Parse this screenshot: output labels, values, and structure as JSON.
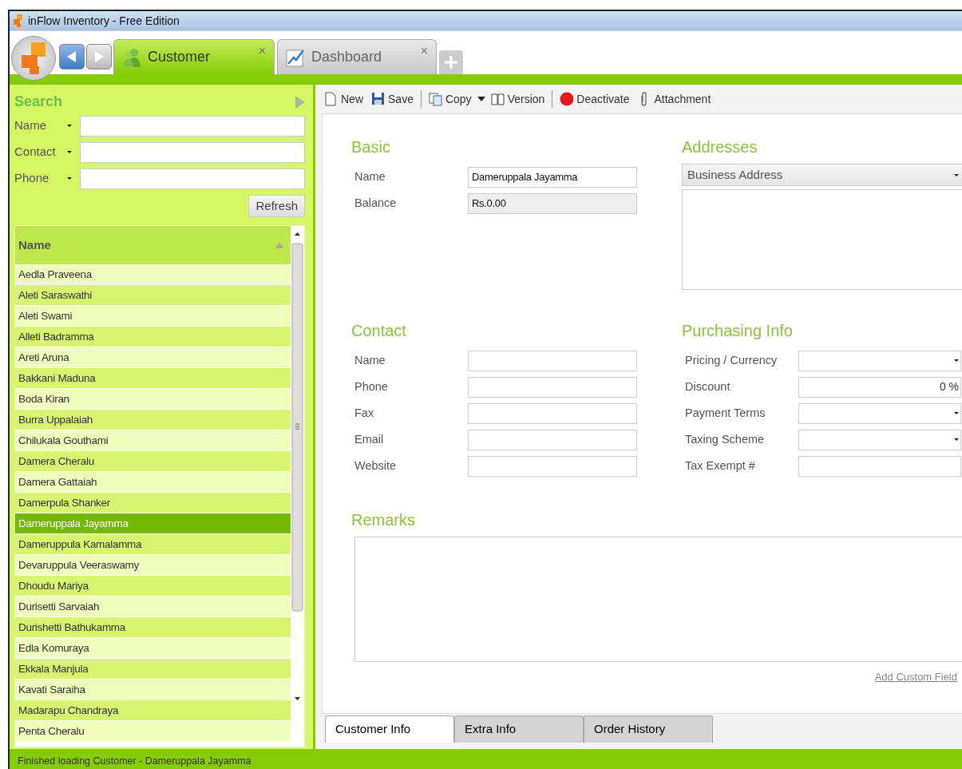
{
  "window": {
    "title": "inFlow Inventory - Free Edition"
  },
  "app_tabs": [
    {
      "label": "Customer",
      "kind": "customer",
      "selected": true,
      "close": "×"
    },
    {
      "label": "Dashboard",
      "kind": "dashboard",
      "selected": false,
      "close": "×"
    }
  ],
  "search": {
    "title": "Search",
    "fields": [
      {
        "label": "Name"
      },
      {
        "label": "Contact"
      },
      {
        "label": "Phone"
      }
    ],
    "refresh": "Refresh"
  },
  "customer_list": {
    "column": "Name",
    "rows": [
      {
        "name": "Aedla Praveena",
        "selected": false
      },
      {
        "name": "Aleti Saraswathi",
        "selected": false
      },
      {
        "name": "Aleti Swami",
        "selected": false
      },
      {
        "name": "Alleti Badramma",
        "selected": false
      },
      {
        "name": "Areti Aruna",
        "selected": false
      },
      {
        "name": "Bakkani Maduna",
        "selected": false
      },
      {
        "name": "Boda Kiran",
        "selected": false
      },
      {
        "name": "Burra Uppalaiah",
        "selected": false
      },
      {
        "name": "Chilukala Gouthami",
        "selected": false
      },
      {
        "name": "Damera Cheralu",
        "selected": false
      },
      {
        "name": "Damera Gattaiah",
        "selected": false
      },
      {
        "name": "Damerpula Shanker",
        "selected": false
      },
      {
        "name": "Dameruppala Jayamma",
        "selected": true
      },
      {
        "name": "Dameruppula Kamalamma",
        "selected": false
      },
      {
        "name": "Devaruppula Veeraswamy",
        "selected": false
      },
      {
        "name": "Dhoudu Mariya",
        "selected": false
      },
      {
        "name": "Durisetti Sarvaiah",
        "selected": false
      },
      {
        "name": "Durishetti Bathukamma",
        "selected": false
      },
      {
        "name": "Edla Komuraya",
        "selected": false
      },
      {
        "name": "Ekkala Manjula",
        "selected": false
      },
      {
        "name": "Kavati Saraiha",
        "selected": false
      },
      {
        "name": "Madarapu Chandraya",
        "selected": false
      },
      {
        "name": "Penta Cheralu",
        "selected": false
      }
    ]
  },
  "toolbar": [
    {
      "label": "New",
      "kind": "new"
    },
    {
      "label": "Save",
      "kind": "save"
    },
    {
      "kind": "separator"
    },
    {
      "label": "Copy",
      "kind": "copy"
    },
    {
      "kind": "caret"
    },
    {
      "label": "Version",
      "kind": "version"
    },
    {
      "kind": "separator"
    },
    {
      "label": "Deactivate",
      "kind": "deactivate"
    },
    {
      "label": "Attachment",
      "kind": "attachment"
    }
  ],
  "basic": {
    "title": "Basic",
    "fields": [
      {
        "label": "Name",
        "value": "Dameruppala Jayamma",
        "kind": "text"
      },
      {
        "label": "Balance",
        "value": "Rs.0.00",
        "kind": "readonly"
      }
    ]
  },
  "addresses": {
    "title": "Addresses",
    "type": "Business Address"
  },
  "contact": {
    "title": "Contact",
    "fields": [
      {
        "label": "Name",
        "kind": "text"
      },
      {
        "label": "Phone",
        "kind": "text"
      },
      {
        "label": "Fax",
        "kind": "text"
      },
      {
        "label": "Email",
        "kind": "text"
      },
      {
        "label": "Website",
        "kind": "text"
      }
    ]
  },
  "purchasing": {
    "title": "Purchasing Info",
    "fields": [
      {
        "label": "Pricing / Currency",
        "kind": "select"
      },
      {
        "label": "Discount",
        "kind": "text",
        "value": "0 %"
      },
      {
        "label": "Payment Terms",
        "kind": "select"
      },
      {
        "label": "Taxing Scheme",
        "kind": "select"
      },
      {
        "label": "Tax Exempt #",
        "kind": "text"
      }
    ]
  },
  "remarks": {
    "title": "Remarks"
  },
  "add_custom_field": "Add Custom Field",
  "bottom_tabs": [
    {
      "label": "Customer Info",
      "selected": true
    },
    {
      "label": "Extra Info",
      "selected": false
    },
    {
      "label": "Order History",
      "selected": false
    }
  ],
  "status_bar": "Finished loading Customer - Dameruppala Jayamma"
}
